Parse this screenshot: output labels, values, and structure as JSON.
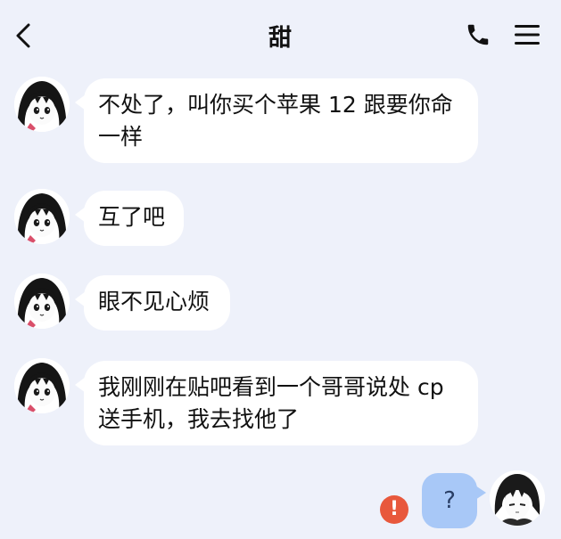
{
  "header": {
    "title": "甜",
    "back_icon": "chevron-left-icon",
    "phone_icon": "phone-icon",
    "menu_icon": "hamburger-menu-icon"
  },
  "messages": [
    {
      "sender": "other",
      "lines": [
        "不处了，叫你买个苹果 12 跟要你命",
        "一样"
      ]
    },
    {
      "sender": "other",
      "lines": [
        "互了吧"
      ]
    },
    {
      "sender": "other",
      "lines": [
        "眼不见心烦"
      ]
    },
    {
      "sender": "other",
      "lines": [
        "我刚刚在贴吧看到一个哥哥说处 cp",
        "送手机，我去找他了"
      ]
    }
  ],
  "my_message": {
    "text": "?",
    "status_icon": "alert-icon",
    "status_text": "!"
  },
  "colors": {
    "background": "#eef1fa",
    "bubble_other": "#ffffff",
    "bubble_mine": "#a8c8f7",
    "alert": "#e8583c"
  }
}
